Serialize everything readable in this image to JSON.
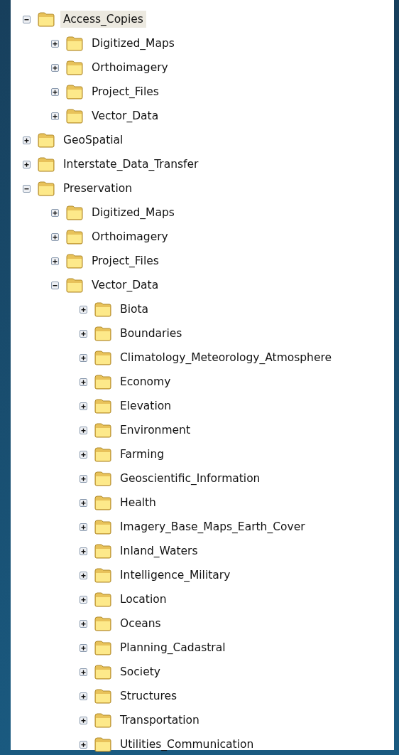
{
  "tree": [
    {
      "label": "Access_Copies",
      "expanded": true,
      "selected": true,
      "children": [
        {
          "label": "Digitized_Maps",
          "expanded": false,
          "selected": false
        },
        {
          "label": "Orthoimagery",
          "expanded": false,
          "selected": false
        },
        {
          "label": "Project_Files",
          "expanded": false,
          "selected": false
        },
        {
          "label": "Vector_Data",
          "expanded": false,
          "selected": false
        }
      ]
    },
    {
      "label": "GeoSpatial",
      "expanded": false,
      "selected": false
    },
    {
      "label": "Interstate_Data_Transfer",
      "expanded": false,
      "selected": false
    },
    {
      "label": "Preservation",
      "expanded": true,
      "selected": false,
      "children": [
        {
          "label": "Digitized_Maps",
          "expanded": false,
          "selected": false
        },
        {
          "label": "Orthoimagery",
          "expanded": false,
          "selected": false
        },
        {
          "label": "Project_Files",
          "expanded": false,
          "selected": false
        },
        {
          "label": "Vector_Data",
          "expanded": true,
          "selected": false,
          "children": [
            {
              "label": "Biota",
              "expanded": false,
              "selected": false
            },
            {
              "label": "Boundaries",
              "expanded": false,
              "selected": false
            },
            {
              "label": "Climatology_Meteorology_Atmosphere",
              "expanded": false,
              "selected": false
            },
            {
              "label": "Economy",
              "expanded": false,
              "selected": false
            },
            {
              "label": "Elevation",
              "expanded": false,
              "selected": false
            },
            {
              "label": "Environment",
              "expanded": false,
              "selected": false
            },
            {
              "label": "Farming",
              "expanded": false,
              "selected": false
            },
            {
              "label": "Geoscientific_Information",
              "expanded": false,
              "selected": false
            },
            {
              "label": "Health",
              "expanded": false,
              "selected": false
            },
            {
              "label": "Imagery_Base_Maps_Earth_Cover",
              "expanded": false,
              "selected": false
            },
            {
              "label": "Inland_Waters",
              "expanded": false,
              "selected": false
            },
            {
              "label": "Intelligence_Military",
              "expanded": false,
              "selected": false
            },
            {
              "label": "Location",
              "expanded": false,
              "selected": false
            },
            {
              "label": "Oceans",
              "expanded": false,
              "selected": false
            },
            {
              "label": "Planning_Cadastral",
              "expanded": false,
              "selected": false
            },
            {
              "label": "Society",
              "expanded": false,
              "selected": false
            },
            {
              "label": "Structures",
              "expanded": false,
              "selected": false
            },
            {
              "label": "Transportation",
              "expanded": false,
              "selected": false
            },
            {
              "label": "Utilities_Communication",
              "expanded": false,
              "selected": false
            }
          ]
        }
      ]
    }
  ]
}
